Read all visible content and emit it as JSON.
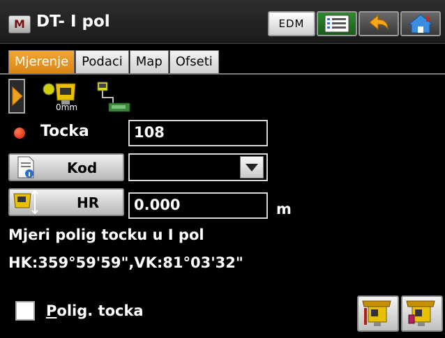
{
  "window": {
    "app_icon": "M",
    "title": "DT- I pol",
    "edm_label": "EDM",
    "icons": [
      "list-icon",
      "back-arrow-icon",
      "home-icon"
    ]
  },
  "tabs": [
    {
      "label": "Mjerenje",
      "active": true
    },
    {
      "label": "Podaci",
      "active": false
    },
    {
      "label": "Map",
      "active": false
    },
    {
      "label": "Ofseti",
      "active": false
    }
  ],
  "toolbar": {
    "instrument_offset": "0mm",
    "icons": [
      "expand-arrow-icon",
      "instrument-icon",
      "connection-icon"
    ]
  },
  "form": {
    "point": {
      "label": "Tocka",
      "value": "108",
      "indicator_color": "#e03010"
    },
    "code": {
      "label": "Kod",
      "value": ""
    },
    "hr": {
      "label": "HR",
      "value": "0.000",
      "unit": "m"
    }
  },
  "status": {
    "message": "Mjeri polig tocku u I pol",
    "angles": "HK:359°59'59\",VK:81°03'32\""
  },
  "bottom": {
    "checkbox_underlined": "P",
    "checkbox_rest": "olig. tocka",
    "checked": false,
    "icons": [
      "measure-store-icon",
      "measure-icon"
    ]
  },
  "colors": {
    "active_tab": "#f0a030",
    "background": "#000000"
  }
}
